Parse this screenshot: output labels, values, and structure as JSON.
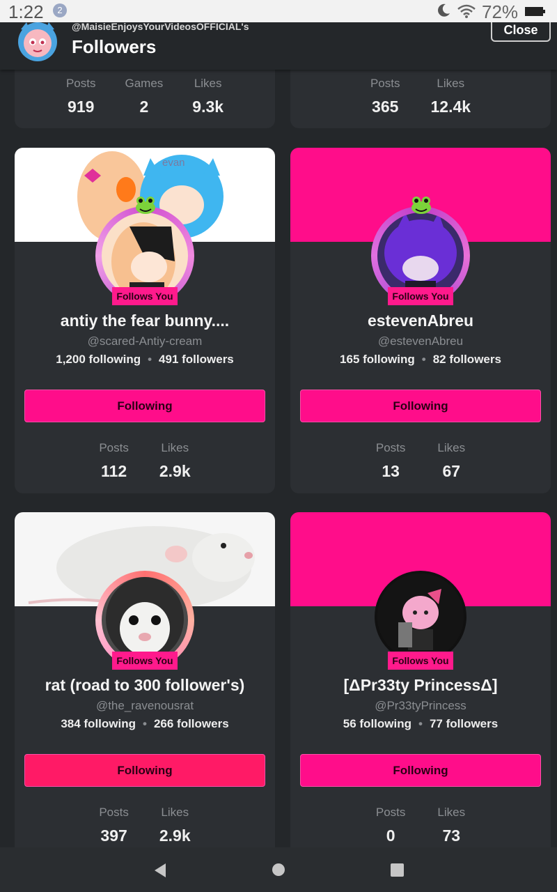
{
  "status_bar": {
    "time": "1:22",
    "notification_count": "2",
    "battery": "72%"
  },
  "header": {
    "handle": "@MaisieEnjoysYourVideosOFFICIAL's",
    "title": "Followers",
    "close_label": "Close"
  },
  "top_cards": [
    {
      "stats": [
        {
          "label": "Posts",
          "value": "919"
        },
        {
          "label": "Games",
          "value": "2"
        },
        {
          "label": "Likes",
          "value": "9.3k"
        }
      ]
    },
    {
      "stats": [
        {
          "label": "Posts",
          "value": "365"
        },
        {
          "label": "Likes",
          "value": "12.4k"
        }
      ]
    }
  ],
  "users": [
    {
      "name": "antiy the fear bunny....",
      "username": "@scared-Antiy-cream",
      "following": "1,200 following",
      "followers": "491 followers",
      "badge": "Follows You",
      "button": "Following",
      "banner_text": "evan",
      "stats": [
        {
          "label": "Posts",
          "value": "112"
        },
        {
          "label": "Likes",
          "value": "2.9k"
        }
      ]
    },
    {
      "name": "estevenAbreu",
      "username": "@estevenAbreu",
      "following": "165 following",
      "followers": "82 followers",
      "badge": "Follows You",
      "button": "Following",
      "stats": [
        {
          "label": "Posts",
          "value": "13"
        },
        {
          "label": "Likes",
          "value": "67"
        }
      ]
    },
    {
      "name": "rat (road to 300 follower's)",
      "username": "@the_ravenousrat",
      "following": "384 following",
      "followers": "266 followers",
      "badge": "Follows You",
      "button": "Following",
      "stats": [
        {
          "label": "Posts",
          "value": "397"
        },
        {
          "label": "Likes",
          "value": "2.9k"
        }
      ]
    },
    {
      "name": "[ΔPr33ty PrincessΔ]",
      "username": "@Pr33tyPrincess",
      "following": "56 following",
      "followers": "77 followers",
      "badge": "Follows You",
      "button": "Following",
      "stats": [
        {
          "label": "Posts",
          "value": "0"
        },
        {
          "label": "Likes",
          "value": "73"
        }
      ]
    }
  ],
  "colors": {
    "accent_pink": "#ff0d8a",
    "background": "#24272a",
    "card": "#2c2f33"
  }
}
